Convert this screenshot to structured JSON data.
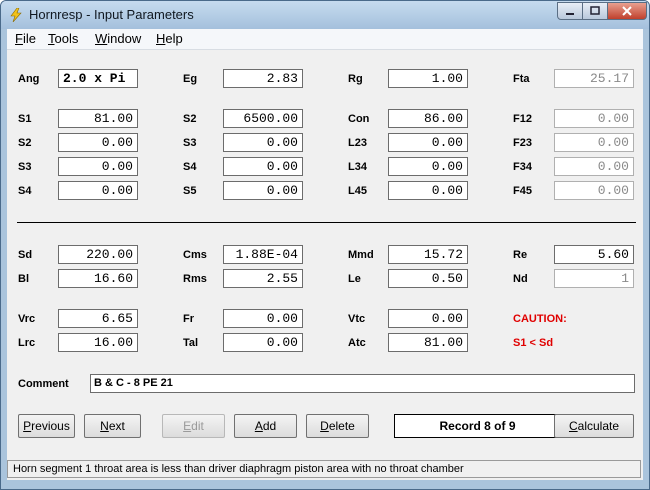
{
  "window": {
    "title": "Hornresp - Input Parameters"
  },
  "menu": [
    {
      "label": "File",
      "accel": "F",
      "rest": "ile"
    },
    {
      "label": "Tools",
      "accel": "T",
      "rest": "ools"
    },
    {
      "label": "Window",
      "accel": "W",
      "rest": "indow"
    },
    {
      "label": "Help",
      "accel": "H",
      "rest": "elp"
    }
  ],
  "params": {
    "ang": {
      "label": "Ang",
      "value": "2.0 x Pi"
    },
    "eg": {
      "label": "Eg",
      "value": "2.83"
    },
    "rg": {
      "label": "Rg",
      "value": "1.00"
    },
    "fta": {
      "label": "Fta",
      "value": "25.17"
    },
    "s1a": {
      "label": "S1",
      "value": "81.00"
    },
    "s2a": {
      "label": "S2",
      "value": "6500.00"
    },
    "con": {
      "label": "Con",
      "value": "86.00"
    },
    "f12": {
      "label": "F12",
      "value": "0.00"
    },
    "s2b": {
      "label": "S2",
      "value": "0.00"
    },
    "s3a": {
      "label": "S3",
      "value": "0.00"
    },
    "l23": {
      "label": "L23",
      "value": "0.00"
    },
    "f23": {
      "label": "F23",
      "value": "0.00"
    },
    "s3b": {
      "label": "S3",
      "value": "0.00"
    },
    "s4a": {
      "label": "S4",
      "value": "0.00"
    },
    "l34": {
      "label": "L34",
      "value": "0.00"
    },
    "f34": {
      "label": "F34",
      "value": "0.00"
    },
    "s4b": {
      "label": "S4",
      "value": "0.00"
    },
    "s5": {
      "label": "S5",
      "value": "0.00"
    },
    "l45": {
      "label": "L45",
      "value": "0.00"
    },
    "f45": {
      "label": "F45",
      "value": "0.00"
    },
    "sd": {
      "label": "Sd",
      "value": "220.00"
    },
    "cms": {
      "label": "Cms",
      "value": "1.88E-04"
    },
    "mmd": {
      "label": "Mmd",
      "value": "15.72"
    },
    "re": {
      "label": "Re",
      "value": "5.60"
    },
    "bl": {
      "label": "Bl",
      "value": "16.60"
    },
    "rms": {
      "label": "Rms",
      "value": "2.55"
    },
    "le": {
      "label": "Le",
      "value": "0.50"
    },
    "nd": {
      "label": "Nd",
      "value": "1"
    },
    "vrc": {
      "label": "Vrc",
      "value": "6.65"
    },
    "fr": {
      "label": "Fr",
      "value": "0.00"
    },
    "vtc": {
      "label": "Vtc",
      "value": "0.00"
    },
    "lrc": {
      "label": "Lrc",
      "value": "16.00"
    },
    "tal": {
      "label": "Tal",
      "value": "0.00"
    },
    "atc": {
      "label": "Atc",
      "value": "81.00"
    }
  },
  "caution": {
    "title": "CAUTION:",
    "message": "S1 < Sd",
    "color": "#e00000"
  },
  "comment": {
    "label": "Comment",
    "value": "B & C - 8 PE 21"
  },
  "buttons": {
    "previous": {
      "accel": "P",
      "rest": "revious"
    },
    "next": {
      "accel": "N",
      "rest": "ext"
    },
    "edit": {
      "accel": "E",
      "rest": "dit"
    },
    "add": {
      "accel": "A",
      "rest": "dd"
    },
    "delete": {
      "accel": "D",
      "rest": "elete"
    },
    "calculate": {
      "accel": "C",
      "rest": "alculate"
    }
  },
  "record": {
    "text": "Record 8 of 9"
  },
  "status": {
    "text": "Horn segment 1 throat area is less than driver diaphragm piston area with no throat chamber"
  },
  "icons": {
    "app": "lightning-icon",
    "minimize": "minimize-icon",
    "maximize": "maximize-icon",
    "close": "close-icon"
  }
}
